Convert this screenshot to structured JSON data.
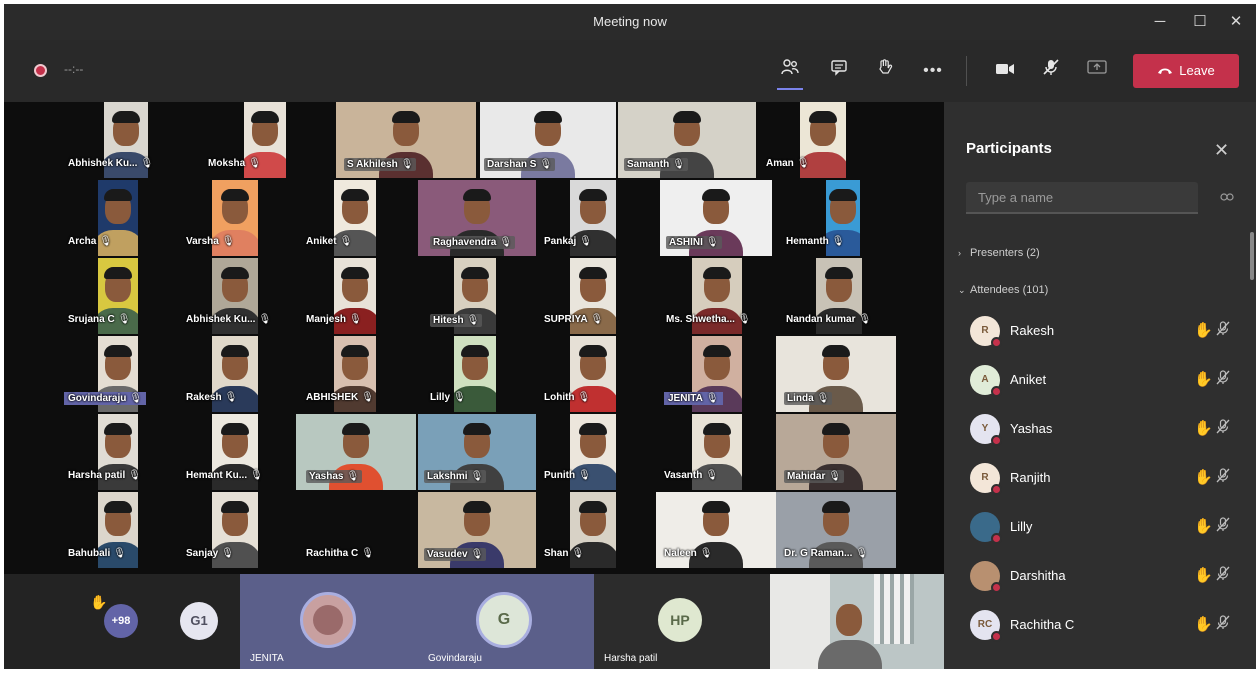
{
  "window": {
    "title": "Meeting now",
    "controls": {
      "minimize": "─",
      "maximize": "☐",
      "close": "✕"
    }
  },
  "toolbar": {
    "timer": "--:--",
    "leave_label": "Leave",
    "icons": [
      "participants-icon",
      "chat-icon",
      "raise-hand-icon",
      "more-icon",
      "camera-icon",
      "mic-muted-icon",
      "share-screen-icon"
    ]
  },
  "grid": [
    {
      "name": "Abhishek Ku...",
      "bg": "#d9d6cf",
      "shirt": "#3a4a6a"
    },
    {
      "name": "Moksha",
      "bg": "#e8e2d8",
      "shirt": "#d04a4a"
    },
    {
      "name": "S Akhilesh",
      "bg": "#c9b49a",
      "shirt": "#5a3030"
    },
    {
      "name": "Darshan S",
      "bg": "#e9e9e9",
      "shirt": "#7a7aa0"
    },
    {
      "name": "Samanth",
      "bg": "#d5d2c8",
      "shirt": "#444444"
    },
    {
      "name": "Aman",
      "bg": "#ece6d6",
      "shirt": "#b04040"
    },
    {
      "name": "Archa",
      "bg": "#1f3a6a",
      "shirt": "#c0a060"
    },
    {
      "name": "Varsha",
      "bg": "#f0a060",
      "shirt": "#e08060"
    },
    {
      "name": "Aniket",
      "bg": "#efe9dd",
      "shirt": "#555555"
    },
    {
      "name": "Raghavendra",
      "bg": "#8a5a7a",
      "shirt": "#2a2a2a"
    },
    {
      "name": "Pankaj",
      "bg": "#d9d9d9",
      "shirt": "#303030"
    },
    {
      "name": "ASHINI",
      "bg": "#efefef",
      "shirt": "#6a3a5a"
    },
    {
      "name": "Hemanth",
      "bg": "#3a9bd5",
      "shirt": "#2a5a9a"
    },
    {
      "name": "Srujana C",
      "bg": "#d8c840",
      "shirt": "#4a6a4a"
    },
    {
      "name": "Abhishek Ku...",
      "bg": "#b0a898",
      "shirt": "#303030"
    },
    {
      "name": "Manjesh",
      "bg": "#e8e2d8",
      "shirt": "#8a2020"
    },
    {
      "name": "Hitesh",
      "bg": "#d8d0c0",
      "shirt": "#3a3a3a"
    },
    {
      "name": "SUPRIYA",
      "bg": "#e9e5dc",
      "shirt": "#8a6a4a"
    },
    {
      "name": "Ms. Shwetha...",
      "bg": "#d6cdbd",
      "shirt": "#7a2a2a"
    },
    {
      "name": "Nandan kumar",
      "bg": "#c8c2b6",
      "shirt": "#2a2a2a"
    },
    {
      "name": "Govindaraju",
      "bg": "#e4ddd2",
      "shirt": "#6a6a6a"
    },
    {
      "name": "Rakesh",
      "bg": "#e0d8ca",
      "shirt": "#2a3a5a"
    },
    {
      "name": "ABHISHEK",
      "bg": "#d8c0b0",
      "shirt": "#503a30"
    },
    {
      "name": "Lilly",
      "bg": "#cfe0c0",
      "shirt": "#3a5a3a"
    },
    {
      "name": "Lohith",
      "bg": "#e6e0d6",
      "shirt": "#c03030"
    },
    {
      "name": "JENITA",
      "bg": "#d0b0a0",
      "shirt": "#5a3a5a"
    },
    {
      "name": "Linda",
      "bg": "#e8e4dc",
      "shirt": "#6a5a4a"
    },
    {
      "name": "Harsha patil",
      "bg": "#e0dcd4",
      "shirt": "#3a3a3a"
    },
    {
      "name": "Hemant Ku...",
      "bg": "#ece8df",
      "shirt": "#2a2a2a"
    },
    {
      "name": "Yashas",
      "bg": "#b8c8c0",
      "shirt": "#e05030"
    },
    {
      "name": "Lakshmi",
      "bg": "#7aa0b8",
      "shirt": "#404040"
    },
    {
      "name": "Punith",
      "bg": "#ece6dc",
      "shirt": "#3a5070"
    },
    {
      "name": "Vasanth",
      "bg": "#e8e2d6",
      "shirt": "#505050"
    },
    {
      "name": "Mahidar",
      "bg": "#b8a898",
      "shirt": "#3a3030"
    },
    {
      "name": "Bahubali",
      "bg": "#dcd6cc",
      "shirt": "#2a4a6a"
    },
    {
      "name": "Sanjay",
      "bg": "#e6e0d6",
      "shirt": "#505050"
    },
    {
      "name": "Rachitha C",
      "bg": "",
      "shirt": ""
    },
    {
      "name": "Vasudev",
      "bg": "#c8b8a0",
      "shirt": "#3a3a6a"
    },
    {
      "name": "Shan",
      "bg": "#d8d2c6",
      "shirt": "#2a2a2a"
    },
    {
      "name": "Naleen",
      "bg": "#efede8",
      "shirt": "#2a2a2a"
    },
    {
      "name": "Dr. G Raman...",
      "bg": "#9aa0a8",
      "shirt": "#5a5a5a"
    }
  ],
  "strip": {
    "hand": "✋",
    "overflow_count": "+98",
    "g1": "G1",
    "jenita_label": "JENITA",
    "govindaraju_initial": "G",
    "govindaraju_label": "Govindaraju",
    "harsha_initials": "HP",
    "harsha_label": "Harsha patil"
  },
  "panel": {
    "title": "Participants",
    "search_placeholder": "Type a name",
    "presenters_label": "Presenters (2)",
    "attendees_label": "Attendees (101)",
    "participants": [
      {
        "initials": "R",
        "name": "Rakesh"
      },
      {
        "initials": "A",
        "name": "Aniket"
      },
      {
        "initials": "Y",
        "name": "Yashas"
      },
      {
        "initials": "R",
        "name": "Ranjith"
      },
      {
        "initials": "",
        "name": "Lilly"
      },
      {
        "initials": "",
        "name": "Darshitha"
      },
      {
        "initials": "RC",
        "name": "Rachitha C"
      }
    ]
  }
}
